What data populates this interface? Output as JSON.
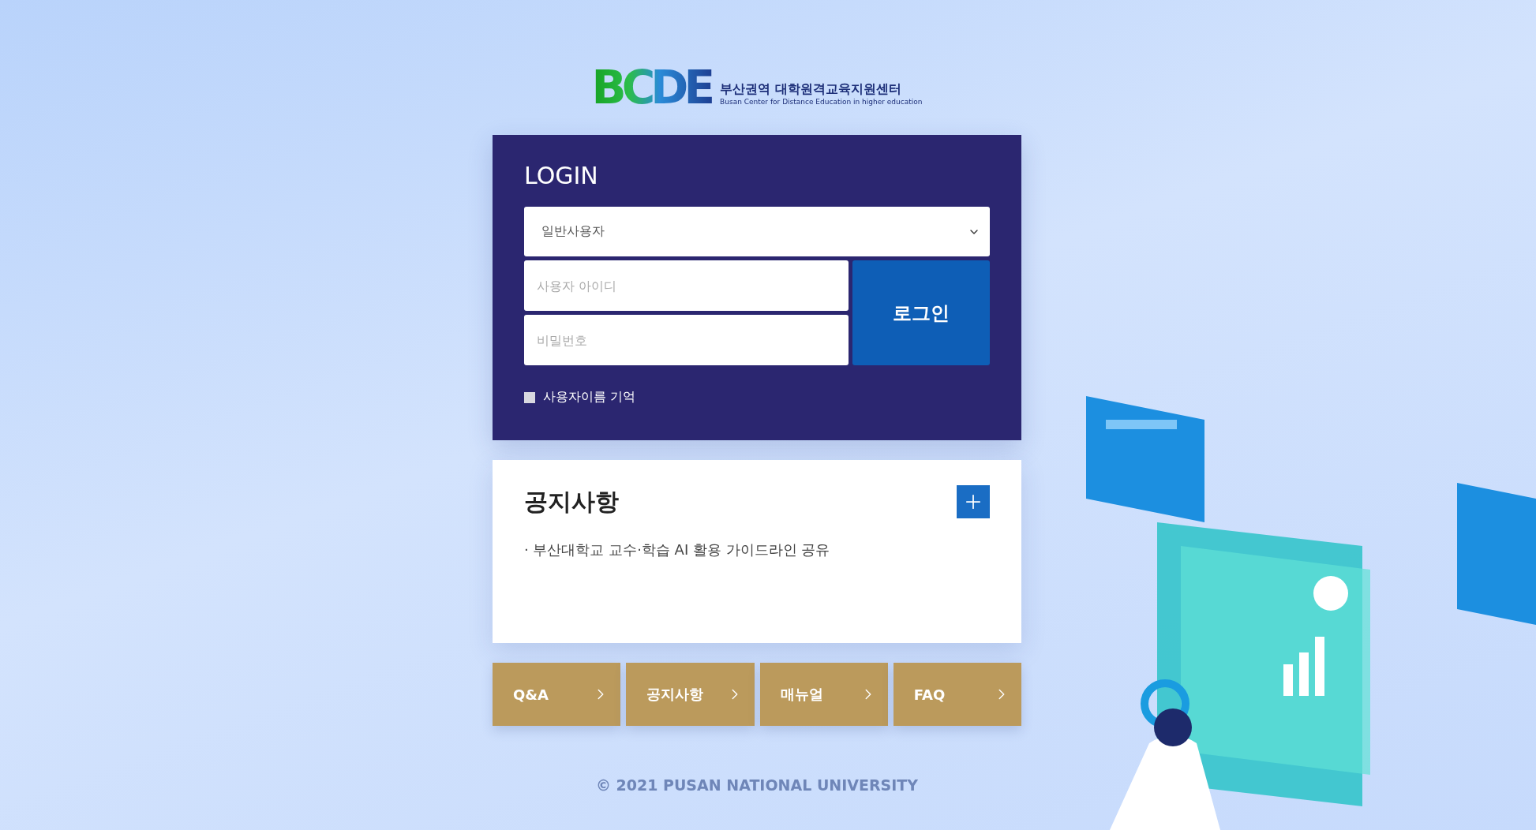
{
  "logo": {
    "mark": "BCDE",
    "title": "부산권역 대학원격교육지원센터",
    "subtitle": "Busan Center for Distance Education in higher education"
  },
  "login": {
    "title": "LOGIN",
    "user_type": {
      "value": "일반사용자"
    },
    "id_field": {
      "placeholder": "사용자 아이디"
    },
    "password_field": {
      "placeholder": "비밀번호"
    },
    "submit": "로그인",
    "remember": {
      "label": "사용자이름 기억",
      "checked": false
    }
  },
  "notice": {
    "title": "공지사항",
    "items": [
      "· 부산대학교 교수·학습 AI 활용 가이드라인 공유"
    ]
  },
  "quick_links": [
    {
      "label": "Q&A"
    },
    {
      "label": "공지사항"
    },
    {
      "label": "매뉴얼"
    },
    {
      "label": "FAQ"
    }
  ],
  "footer": "© 2021 PUSAN NATIONAL UNIVERSITY"
}
